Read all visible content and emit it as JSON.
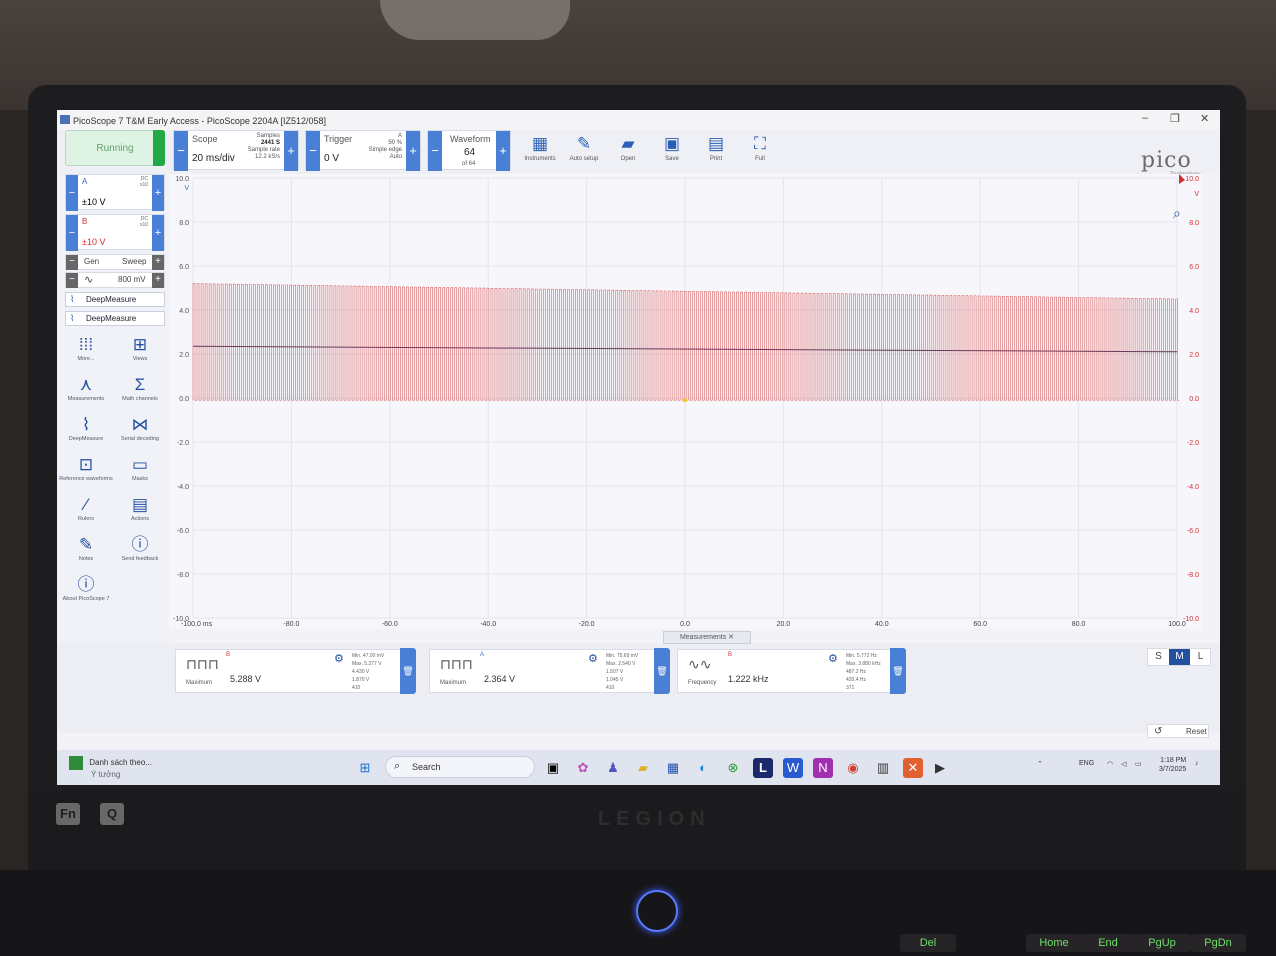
{
  "window": {
    "title": "PicoScope 7 T&M Early Access - PicoScope 2204A [IZ512/058]"
  },
  "toolbar": {
    "running": "Running",
    "scope": {
      "title": "Scope",
      "value": "20 ms/div",
      "samples_label": "Samples",
      "samples": "2441 S",
      "rate_label": "Sample rate",
      "rate": "12.2 kS/s"
    },
    "trigger": {
      "title": "Trigger",
      "value": "0 V",
      "ch": "A",
      "pct": "50 %",
      "type": "Simple edge",
      "mode": "Auto"
    },
    "waveform": {
      "title": "Waveform",
      "value": "64",
      "sub": "of 64"
    },
    "tools": [
      {
        "label": "Instruments",
        "icon": "instruments-icon",
        "glyph": "▦"
      },
      {
        "label": "Auto setup",
        "icon": "auto-setup-icon",
        "glyph": "✎"
      },
      {
        "label": "Open",
        "icon": "folder-icon",
        "glyph": "▰"
      },
      {
        "label": "Save",
        "icon": "save-icon",
        "glyph": "▣"
      },
      {
        "label": "Print",
        "icon": "print-icon",
        "glyph": "▤"
      },
      {
        "label": "Full",
        "icon": "fullscreen-icon",
        "glyph": "⛶"
      }
    ],
    "logo": "pico",
    "logo_sub": "Technology",
    "notification_count": "4"
  },
  "channels": [
    {
      "name": "A",
      "range": "±10 V",
      "coupling": "DC",
      "probe": "x10",
      "color": "#3a66c4"
    },
    {
      "name": "B",
      "range": "±10 V",
      "coupling": "DC",
      "probe": "x10",
      "color": "#d03030"
    }
  ],
  "generator": {
    "label": "Gen",
    "mode": "Sweep",
    "amplitude": "800 mV"
  },
  "deepmeasure": [
    "DeepMeasure",
    "DeepMeasure"
  ],
  "left_tools": [
    {
      "label": "More...",
      "icon": "more-icon",
      "glyph": "⁞⁞⁞"
    },
    {
      "label": "Views",
      "icon": "views-icon",
      "glyph": "⊞"
    },
    {
      "label": "Measurements",
      "icon": "measurements-icon",
      "glyph": "⋏"
    },
    {
      "label": "Math channels",
      "icon": "sigma-icon",
      "glyph": "Σ"
    },
    {
      "label": "DeepMeasure",
      "icon": "deepmeasure-icon",
      "glyph": "⌇"
    },
    {
      "label": "Serial decoding",
      "icon": "serial-decoding-icon",
      "glyph": "⋈"
    },
    {
      "label": "Reference waveforms",
      "icon": "reference-icon",
      "glyph": "⊡"
    },
    {
      "label": "Masks",
      "icon": "masks-icon",
      "glyph": "▭"
    },
    {
      "label": "Rulers",
      "icon": "rulers-icon",
      "glyph": "⁄"
    },
    {
      "label": "Actions",
      "icon": "actions-icon",
      "glyph": "▤"
    },
    {
      "label": "Notes",
      "icon": "notes-icon",
      "glyph": "✎"
    },
    {
      "label": "Send feedback",
      "icon": "feedback-icon",
      "glyph": "ⓘ"
    },
    {
      "label": "About PicoScope 7",
      "icon": "info-icon",
      "glyph": "ⓘ"
    }
  ],
  "chart_data": {
    "type": "line",
    "x_unit": "ms",
    "xlim": [
      -100,
      100
    ],
    "x_ticks": [
      "-100.0 ms",
      "-80.0",
      "-60.0",
      "-40.0",
      "-20.0",
      "0.0",
      "20.0",
      "40.0",
      "60.0",
      "80.0",
      "100.0"
    ],
    "y_left_ticks": [
      "10.0",
      "8.0",
      "6.0",
      "4.0",
      "2.0",
      "0.0",
      "-2.0",
      "-4.0",
      "-6.0",
      "-8.0",
      "-10.0"
    ],
    "y_left_unit": "V",
    "y_right_ticks": [
      "10.0",
      "8.0",
      "6.0",
      "4.0",
      "2.0",
      "0.0",
      "-2.0",
      "-4.0",
      "-6.0",
      "-8.0",
      "-10.0"
    ],
    "y_right_unit": "V",
    "ylim": [
      -10,
      10
    ],
    "series": [
      {
        "name": "B",
        "color": "#d03030",
        "style": "square",
        "high": 5.2,
        "low": -0.1,
        "frequency_hz": 1222
      },
      {
        "name": "A",
        "color": "#3a66c4",
        "style": "flat",
        "value_start": 2.35,
        "value_end": 2.1
      }
    ]
  },
  "measurements": {
    "tab": "Measurements",
    "cards": [
      {
        "channel": "B",
        "kind": "Maximum",
        "value": "5.288 V",
        "min": "Min. 47.00 mV",
        "max": "Max. 5.377 V",
        "mean": "4.430 V",
        "sd": "1.870 V",
        "n": "410"
      },
      {
        "channel": "A",
        "kind": "Maximum",
        "value": "2.364 V",
        "min": "Min. 75.69 mV",
        "max": "Max. 2.540 V",
        "mean": "1.507 V",
        "sd": "1.045 V",
        "n": "410"
      },
      {
        "channel": "B",
        "kind": "Frequency",
        "value": "1.222 kHz",
        "min": "Min. 5.772 Hz",
        "max": "Max. 3.880 kHz",
        "mean": "487.2 Hz",
        "sd": "420.4 Hz",
        "n": "371"
      }
    ]
  },
  "sizes": [
    "S",
    "M",
    "L"
  ],
  "reset": "Reset",
  "taskbar": {
    "news_title": "Danh sách theo...",
    "news_sub": "Ý tưởng",
    "search": "Search",
    "lang": "ENG",
    "time": "1:18 PM",
    "date": "3/7/2025"
  },
  "laptop": {
    "brand": "LEGION",
    "fn": "Fn",
    "q": "Q",
    "keys": [
      "Del",
      "Home",
      "End",
      "PgUp",
      "PgDn"
    ]
  }
}
